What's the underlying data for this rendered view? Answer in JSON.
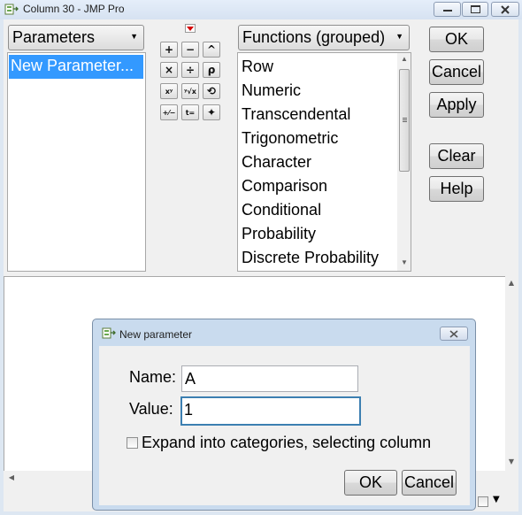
{
  "window": {
    "title": "Column 30 - JMP Pro"
  },
  "parameters_combo": {
    "label": "Parameters"
  },
  "parameters_list": {
    "items": [
      "New Parameter..."
    ]
  },
  "functions_combo": {
    "label": "Functions (grouped)"
  },
  "functions_list": {
    "items": [
      "Row",
      "Numeric",
      "Transcendental",
      "Trigonometric",
      "Character",
      "Comparison",
      "Conditional",
      "Probability",
      "Discrete Probability"
    ]
  },
  "keypad": {
    "keys": [
      {
        "name": "add-key",
        "glyph": "+"
      },
      {
        "name": "subtract-key",
        "glyph": "−"
      },
      {
        "name": "raise-key",
        "glyph": "^"
      },
      {
        "name": "multiply-key",
        "glyph": "×"
      },
      {
        "name": "divide-key",
        "glyph": "÷"
      },
      {
        "name": "peel-key",
        "glyph": "ρ"
      },
      {
        "name": "power-key",
        "glyph": "xʸ"
      },
      {
        "name": "root-key",
        "glyph": "ʸ√x"
      },
      {
        "name": "swap-key",
        "glyph": "⟲"
      },
      {
        "name": "negate-key",
        "glyph": "+⁄−"
      },
      {
        "name": "assign-key",
        "glyph": "t="
      },
      {
        "name": "fire-key",
        "glyph": "✦"
      }
    ]
  },
  "buttons": {
    "ok": "OK",
    "cancel": "Cancel",
    "apply": "Apply",
    "clear": "Clear",
    "help": "Help"
  },
  "dialog": {
    "title": "New parameter",
    "name_label": "Name:",
    "name_value": "A",
    "value_label": "Value:",
    "value_value": "1",
    "checkbox_label": "Expand into categories, selecting column",
    "checkbox_checked": false,
    "ok": "OK",
    "cancel": "Cancel"
  },
  "colors": {
    "selection": "#3399ff",
    "focus_border": "#3c7fb1",
    "title_bg": "#dde7f2"
  }
}
